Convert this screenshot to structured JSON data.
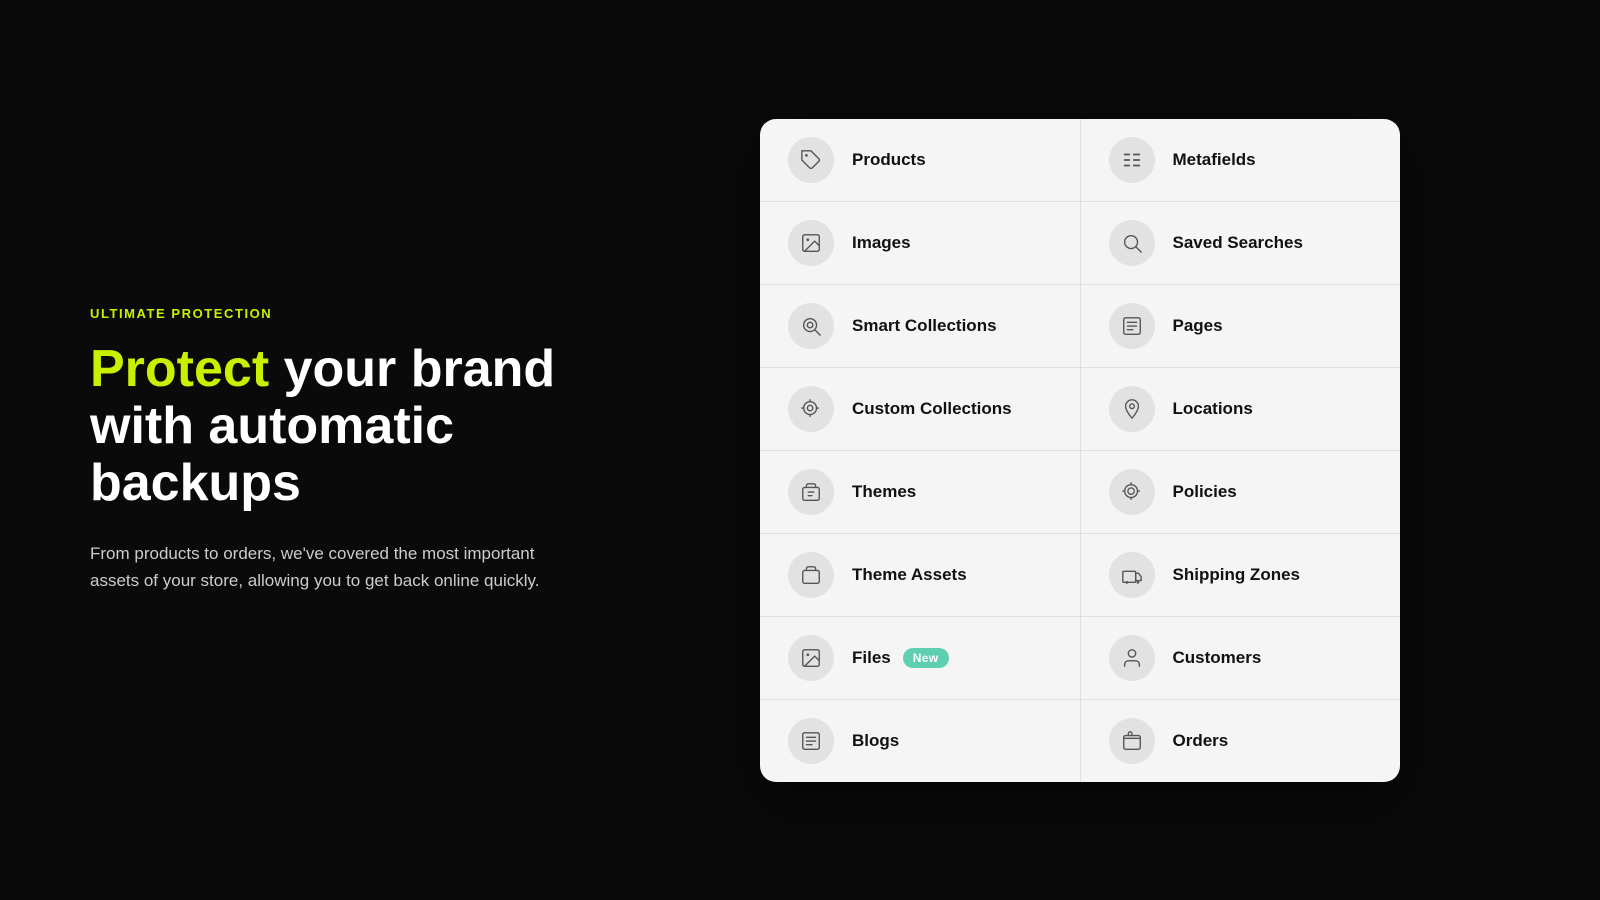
{
  "left": {
    "tagline": "ULTIMATE PROTECTION",
    "headline_part1": "Protect",
    "headline_part2": " your brand\nwith automatic backups",
    "description": "From products to orders, we've covered the most important assets of your store, allowing you to get back online quickly."
  },
  "grid": {
    "rows": [
      {
        "cells": [
          {
            "id": "products",
            "label": "Products",
            "icon": "tag"
          },
          {
            "id": "metafields",
            "label": "Metafields",
            "icon": "list-details"
          }
        ]
      },
      {
        "cells": [
          {
            "id": "images",
            "label": "Images",
            "icon": "image"
          },
          {
            "id": "saved-searches",
            "label": "Saved Searches",
            "icon": "search"
          }
        ]
      },
      {
        "cells": [
          {
            "id": "smart-collections",
            "label": "Smart Collections",
            "icon": "smart-collection"
          },
          {
            "id": "pages",
            "label": "Pages",
            "icon": "pages"
          }
        ]
      },
      {
        "cells": [
          {
            "id": "custom-collections",
            "label": "Custom Collections",
            "icon": "custom-collection"
          },
          {
            "id": "locations",
            "label": "Locations",
            "icon": "location"
          }
        ]
      },
      {
        "cells": [
          {
            "id": "themes",
            "label": "Themes",
            "icon": "themes"
          },
          {
            "id": "policies",
            "label": "Policies",
            "icon": "policies"
          }
        ]
      },
      {
        "cells": [
          {
            "id": "theme-assets",
            "label": "Theme Assets",
            "icon": "theme-assets"
          },
          {
            "id": "shipping-zones",
            "label": "Shipping Zones",
            "icon": "shipping"
          }
        ]
      },
      {
        "cells": [
          {
            "id": "files",
            "label": "Files",
            "icon": "files",
            "badge": "New"
          },
          {
            "id": "customers",
            "label": "Customers",
            "icon": "customer"
          }
        ]
      },
      {
        "cells": [
          {
            "id": "blogs",
            "label": "Blogs",
            "icon": "blogs"
          },
          {
            "id": "orders",
            "label": "Orders",
            "icon": "orders"
          }
        ]
      }
    ]
  }
}
